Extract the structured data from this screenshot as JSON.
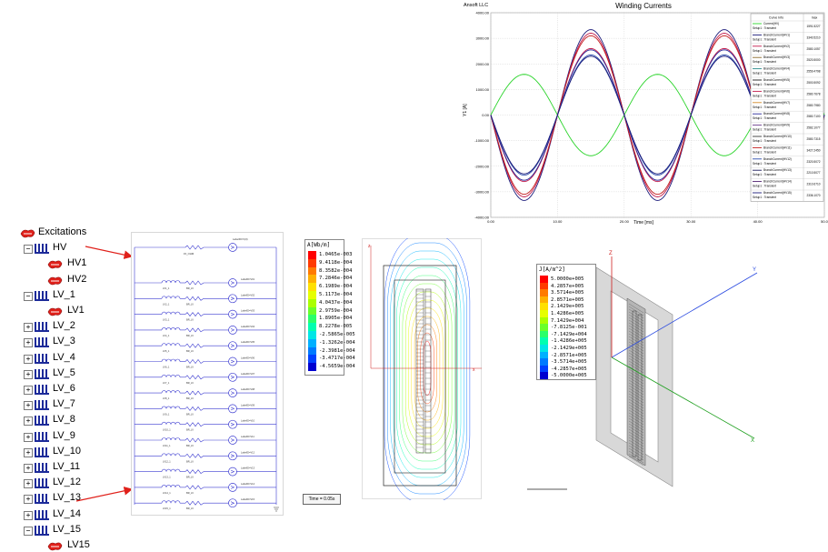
{
  "tree": {
    "root_label": "Excitations",
    "hv_group": {
      "label": "HV",
      "toggle": "−",
      "children": [
        "HV1",
        "HV2"
      ]
    },
    "lv_groups": [
      {
        "label": "LV_1",
        "toggle": "−",
        "children": [
          "LV1"
        ]
      },
      {
        "label": "LV_2",
        "toggle": "+"
      },
      {
        "label": "LV_3",
        "toggle": "+"
      },
      {
        "label": "LV_4",
        "toggle": "+"
      },
      {
        "label": "LV_5",
        "toggle": "+"
      },
      {
        "label": "LV_6",
        "toggle": "+"
      },
      {
        "label": "LV_7",
        "toggle": "+"
      },
      {
        "label": "LV_8",
        "toggle": "+"
      },
      {
        "label": "LV_9",
        "toggle": "+"
      },
      {
        "label": "LV_10",
        "toggle": "+"
      },
      {
        "label": "LV_11",
        "toggle": "+"
      },
      {
        "label": "LV_12",
        "toggle": "+"
      },
      {
        "label": "LV_13",
        "toggle": "+"
      },
      {
        "label": "LV_14",
        "toggle": "+"
      },
      {
        "label": "LV_15",
        "toggle": "−",
        "children": [
          "LV15"
        ]
      }
    ]
  },
  "colors": {
    "arrow": "#e0201a",
    "coil_icon": "#1c2a99",
    "hv_current": "#2ad42a",
    "circuit_wire": "#3a3ad0"
  },
  "chart_data": {
    "type": "line",
    "header_left": "Ansoft LLC",
    "title": "Winding Currents",
    "xlabel": "Time [ms]",
    "ylabel": "Y1 [A]",
    "xlim": [
      0,
      50
    ],
    "ylim": [
      -4000,
      4000
    ],
    "x_ticks": [
      "0.00",
      "10.00",
      "20.00",
      "30.00",
      "40.00",
      "50.0"
    ],
    "y_ticks": [
      "4000.00",
      "3000.00",
      "2000.00",
      "1000.00",
      "0.00",
      "-1000.00",
      "-2000.00",
      "-3000.00",
      "-4000.00"
    ],
    "grid": true,
    "legend_position": "right",
    "legend_header": [
      "Curve Info",
      "max"
    ],
    "legend_rows": [
      {
        "name": "Current(HV)",
        "setup": "Setup1 : Transient",
        "max": "1591.5227",
        "color": "#2ad42a"
      },
      {
        "name": "BranchCurrent(HV1)",
        "setup": "Setup1 : Transient",
        "max": "3340.5210",
        "color": "#1a1a7a"
      },
      {
        "name": "BranchCurrent(HV2)",
        "setup": "Setup1 : Transient",
        "max": "2580.1057",
        "color": "#c21a4a"
      },
      {
        "name": "BranchCurrent(HV3)",
        "setup": "Setup1 : Transient",
        "max": "2520.5000",
        "color": "#8a6a2a"
      },
      {
        "name": "BranchCurrent(HV4)",
        "setup": "Setup1 : Transient",
        "max": "2559.4798",
        "color": "#2a8a8a"
      },
      {
        "name": "BranchCurrent(HV5)",
        "setup": "Setup1 : Transient",
        "max": "2500.5092",
        "color": "#1a1a1a"
      },
      {
        "name": "BranchCurrent(HV6)",
        "setup": "Setup1 : Transient",
        "max": "2580.7678",
        "color": "#c21a4a"
      },
      {
        "name": "BranchCurrent(HV7)",
        "setup": "Setup1 : Transient",
        "max": "2580.7980",
        "color": "#d48a2a"
      },
      {
        "name": "BranchCurrent(HV8)",
        "setup": "Setup1 : Transient",
        "max": "2580.7100",
        "color": "#2a2a9a"
      },
      {
        "name": "BranchCurrent(HV9)",
        "setup": "Setup1 : Transient",
        "max": "2582.1077",
        "color": "#6a3a8a"
      },
      {
        "name": "BranchCurrent(HV10)",
        "setup": "Setup1 : Transient",
        "max": "2580.7315",
        "color": "#3a3a3a"
      },
      {
        "name": "BranchCurrent(HV11)",
        "setup": "Setup1 : Transient",
        "max": "3427.2450",
        "color": "#c21a1a"
      },
      {
        "name": "BranchCurrent(HV12)",
        "setup": "Setup1 : Transient",
        "max": "2320.5072",
        "color": "#2a4aaa"
      },
      {
        "name": "BranchCurrent(HV13)",
        "setup": "Setup1 : Transient",
        "max": "2210.5077",
        "color": "#1a1a5a"
      },
      {
        "name": "BranchCurrent(HV14)",
        "setup": "Setup1 : Transient",
        "max": "2310.6710",
        "color": "#4a1a6a"
      },
      {
        "name": "BranchCurrent(HV15)",
        "setup": "Setup1 : Transient",
        "max": "2336.1070",
        "color": "#1a1a7a"
      }
    ],
    "series": [
      {
        "name": "Current(HV)",
        "amplitude": 1591.5,
        "phase": "positive",
        "period_ms": 20
      },
      {
        "name": "BranchCurrent(HV1)",
        "amplitude": 3340,
        "phase": "negative",
        "period_ms": 20
      },
      {
        "name": "BranchCurrent(HV2)",
        "amplitude": 3200,
        "phase": "negative",
        "period_ms": 20
      },
      {
        "name": "BranchCurrent(HV11)",
        "amplitude": 3100,
        "phase": "negative",
        "period_ms": 20
      },
      {
        "name": "BranchCurrent(HV6)",
        "amplitude": 2600,
        "phase": "negative",
        "period_ms": 20
      },
      {
        "name": "BranchCurrent(HV8)",
        "amplitude": 2550,
        "phase": "negative",
        "period_ms": 20
      },
      {
        "name": "BranchCurrent(HV12)",
        "amplitude": 2350,
        "phase": "negative",
        "period_ms": 20
      },
      {
        "name": "BranchCurrent(HV15)",
        "amplitude": 2300,
        "phase": "negative",
        "period_ms": 20
      }
    ]
  },
  "circuit": {
    "top_source_label": "LabelID=V(0)",
    "top_resistor_label": "15_OHM",
    "rows": [
      {
        "coil": "LV1_1",
        "res": "BR_LV",
        "src": "LabelID=V01"
      },
      {
        "coil": "LV2_1",
        "res": "BR_LV",
        "src": "LabelID=V02"
      },
      {
        "coil": "LV3_1",
        "res": "BR_LV",
        "src": "LabelID=V03"
      },
      {
        "coil": "LV4_1",
        "res": "BR_LV",
        "src": "LabelID=V04"
      },
      {
        "coil": "LV5_1",
        "res": "BR_LV",
        "src": "LabelID=V05"
      },
      {
        "coil": "LV6_1",
        "res": "BR_LV",
        "src": "LabelID=V06"
      },
      {
        "coil": "LV7_1",
        "res": "BR_LV",
        "src": "LabelID=V07"
      },
      {
        "coil": "LV8_1",
        "res": "BR_LV",
        "src": "LabelID=V08"
      },
      {
        "coil": "LV9_1",
        "res": "BR_LV",
        "src": "LabelID=V09"
      },
      {
        "coil": "LV10_1",
        "res": "BR_LV",
        "src": "LabelID=V10"
      },
      {
        "coil": "LV11_1",
        "res": "BR_LV",
        "src": "LabelID=V11"
      },
      {
        "coil": "LV12_1",
        "res": "BR_LV",
        "src": "LabelID=V12"
      },
      {
        "coil": "LV13_1",
        "res": "BR_LV",
        "src": "LabelID=V13"
      },
      {
        "coil": "LV14_1",
        "res": "BR_LV",
        "src": "LabelID=V14"
      },
      {
        "coil": "LV15_1",
        "res": "BR_LV",
        "src": "LabelID=V15"
      }
    ]
  },
  "flux_plot": {
    "legend_title": "A[Wb/m]",
    "legend_values": [
      "1.0465e-003",
      "9.4118e-004",
      "8.3582e-004",
      "7.2846e-004",
      "6.1989e-004",
      "5.1173e-004",
      "4.0437e-004",
      "2.9759e-004",
      "1.8905e-004",
      "8.2278e-005",
      "-2.5865e-005",
      "-1.3262e-004",
      "-2.3981e-004",
      "-3.4717e-004",
      "-4.5659e-004"
    ],
    "legend_colors": [
      "#ff0000",
      "#ff3a00",
      "#ff7a00",
      "#ffb000",
      "#ffe000",
      "#e6ff00",
      "#aaff00",
      "#6aff2a",
      "#2aff6a",
      "#00ffb0",
      "#00e6e6",
      "#00b0ff",
      "#007aff",
      "#0040ff",
      "#0000d0"
    ],
    "time_label": "Time = 0.05s",
    "axis_x": "x",
    "axis_z": "z"
  },
  "current_plot": {
    "legend_title": "J[A/m^2]",
    "legend_values": [
      "5.0000e+005",
      "4.2857e+005",
      "3.5714e+005",
      "2.8571e+005",
      "2.1429e+005",
      "1.4286e+005",
      "7.1429e+004",
      "-7.8125e-001",
      "-7.1429e+004",
      "-1.4286e+005",
      "-2.1429e+005",
      "-2.8571e+005",
      "-3.5714e+005",
      "-4.2857e+005",
      "-5.0000e+005"
    ],
    "legend_colors": [
      "#ff0000",
      "#ff3a00",
      "#ff7a00",
      "#ffb000",
      "#ffe000",
      "#e6ff00",
      "#aaff00",
      "#6aff2a",
      "#2aff6a",
      "#00ffb0",
      "#00e6e6",
      "#00b0ff",
      "#007aff",
      "#0040ff",
      "#0000d0"
    ],
    "axis_x": "X",
    "axis_y": "Y",
    "axis_z": "Z"
  }
}
